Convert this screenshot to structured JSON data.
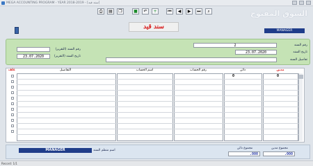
{
  "window": {
    "title": "MEGA ACCOUNTING PROGRAM - YEAR 2018-2019 - [سند قيد]"
  },
  "toolbar": {
    "buttons": [
      "print-icon",
      "preview-icon",
      "copy-icon",
      "save-icon",
      "undo-icon",
      "add-icon",
      "first-icon",
      "prev-icon",
      "next-icon",
      "last-icon",
      "find-icon"
    ]
  },
  "brand": {
    "text": "السوق المفتوح"
  },
  "document": {
    "title": "سند قيد",
    "user_badge": "MANAGER"
  },
  "header": {
    "doc_number_label": "رقم السند",
    "doc_number": "2",
    "doc_date_label": "تاريخ السند",
    "doc_date": "23.07.2020",
    "details_label": "تفاصيل السند",
    "details": "",
    "ref_number_label": "رقم السند (التقرير)",
    "ref_number": "",
    "ref_date_label": "تاريخ السند (التقرير)",
    "ref_date": "23.07.2020"
  },
  "grid": {
    "columns": {
      "debit": "مدين",
      "credit": "دائن",
      "account_no": "رقم الحساب",
      "account_name": "اسم الحساب",
      "details": "التفاصيل",
      "flag": "علف"
    },
    "rows": [
      {
        "debit": "0",
        "credit": "0"
      }
    ]
  },
  "footer": {
    "organizer_label": "اسم منظم السند",
    "organizer": "MANAGER",
    "total_debit_label": "مجموع مدين",
    "total_debit": ".000",
    "total_credit_label": "مجموع دائن",
    "total_credit": ".000"
  },
  "status": {
    "record": "Record: 1/1"
  }
}
